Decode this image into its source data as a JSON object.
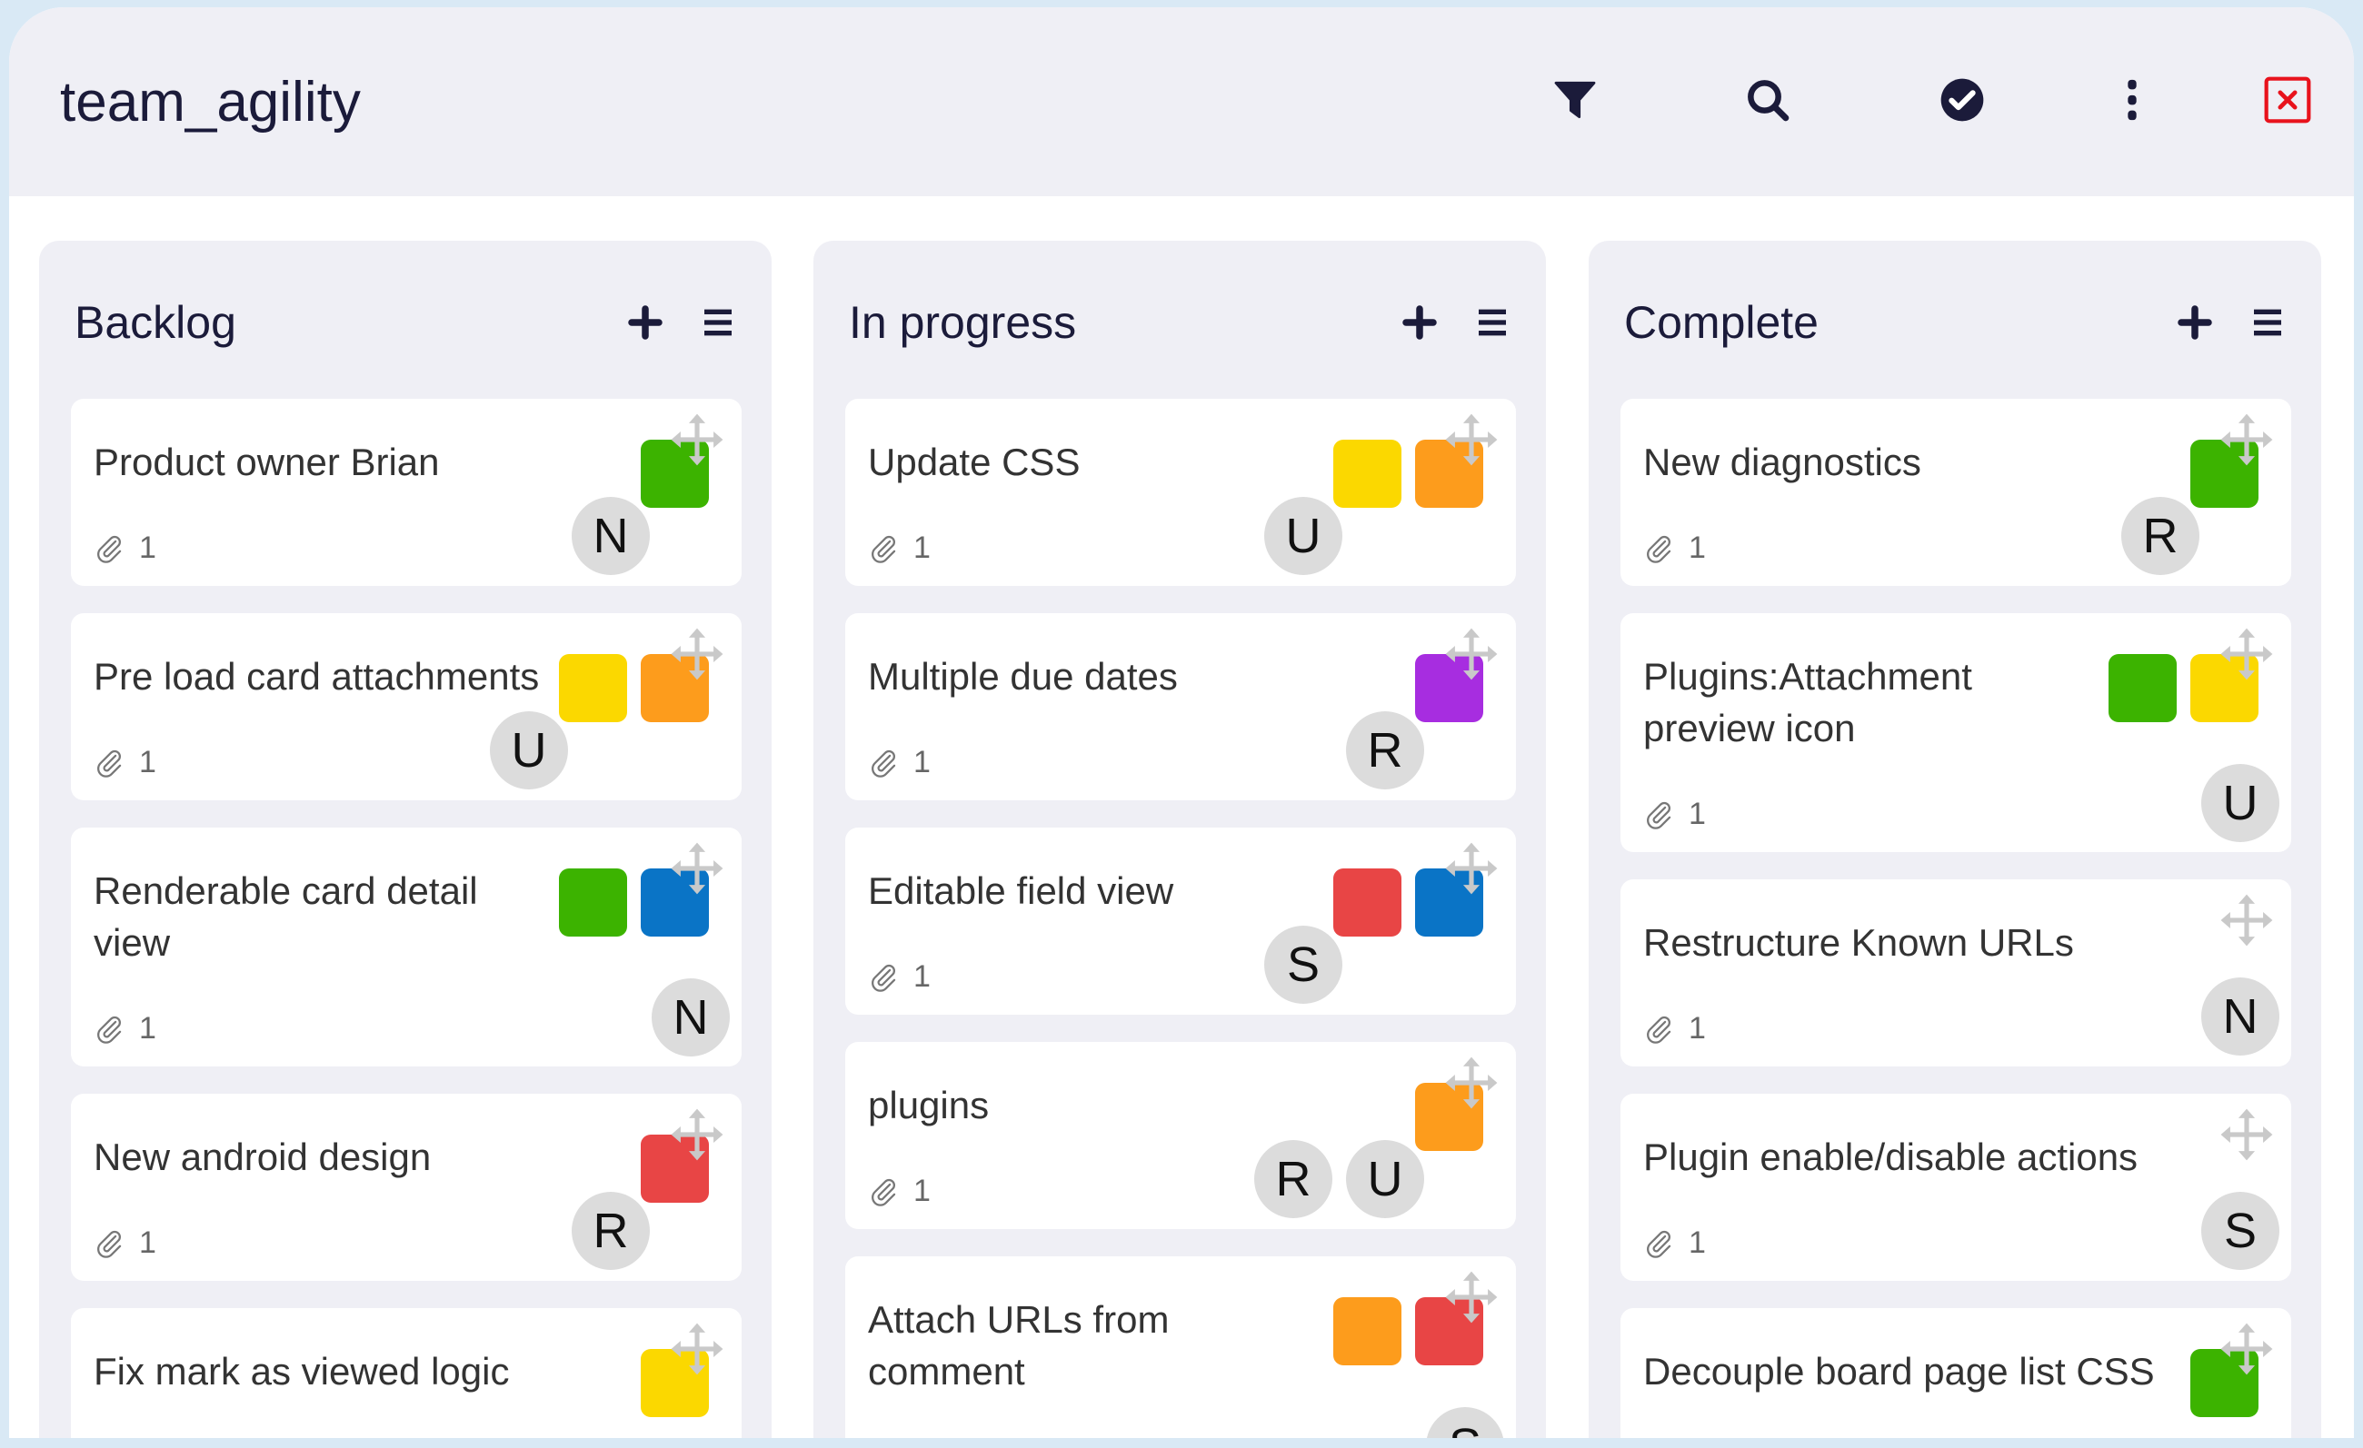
{
  "board": {
    "title": "team_agility"
  },
  "toolbar": {
    "icons": [
      "filter-icon",
      "search-icon",
      "check-circle-icon",
      "more-vertical-icon",
      "close-icon"
    ],
    "close_color": "#e8121c"
  },
  "colors": {
    "header_bg": "#efeff5",
    "column_bg": "#efeff5",
    "text": "#1b1b3a",
    "avatar_bg": "#dcdcdc"
  },
  "columns": [
    {
      "title": "Backlog",
      "cards": [
        {
          "title": "Product owner Brian",
          "attachments": "1",
          "tags": [
            "#3cb300"
          ],
          "members": [
            "N"
          ]
        },
        {
          "title": "Pre load card attachments",
          "attachments": "1",
          "tags": [
            "#fbd800",
            "#fd9c1c"
          ],
          "members": [
            "U"
          ]
        },
        {
          "title": "Renderable card detail view",
          "attachments": "1",
          "tags": [
            "#3cb300",
            "#0a74c6"
          ],
          "members": [
            "N"
          ]
        },
        {
          "title": "New android design",
          "attachments": "1",
          "tags": [
            "#e84545"
          ],
          "members": [
            "R"
          ]
        },
        {
          "title": "Fix mark as viewed logic",
          "tags": [
            "#fbd800"
          ],
          "members": []
        }
      ]
    },
    {
      "title": "In progress",
      "cards": [
        {
          "title": "Update CSS",
          "attachments": "1",
          "tags": [
            "#fbd800",
            "#fd9c1c"
          ],
          "members": [
            "U"
          ]
        },
        {
          "title": "Multiple due dates",
          "attachments": "1",
          "tags": [
            "#a72de0"
          ],
          "members": [
            "R"
          ]
        },
        {
          "title": "Editable field view",
          "attachments": "1",
          "tags": [
            "#e84545",
            "#0a74c6"
          ],
          "members": [
            "S"
          ]
        },
        {
          "title": "plugins",
          "attachments": "1",
          "tags": [
            "#fd9c1c"
          ],
          "members": [
            "R",
            "U"
          ]
        },
        {
          "title": "Attach URLs from comment",
          "tags": [
            "#fd9c1c",
            "#e84545"
          ],
          "members": [
            "S"
          ]
        }
      ]
    },
    {
      "title": "Complete",
      "cards": [
        {
          "title": "New diagnostics",
          "attachments": "1",
          "tags": [
            "#3cb300"
          ],
          "members": [
            "R"
          ]
        },
        {
          "title": "Plugins:Attachment preview icon",
          "attachments": "1",
          "tags": [
            "#3cb300",
            "#fbd800"
          ],
          "members": [
            "U"
          ]
        },
        {
          "title": "Restructure Known URLs",
          "attachments": "1",
          "tags": [],
          "members": [
            "N"
          ]
        },
        {
          "title": "Plugin enable/disable actions",
          "attachments": "1",
          "tags": [],
          "members": [
            "S"
          ]
        },
        {
          "title": "Decouple board page list CSS",
          "tags": [
            "#3cb300"
          ],
          "members": []
        }
      ]
    }
  ]
}
